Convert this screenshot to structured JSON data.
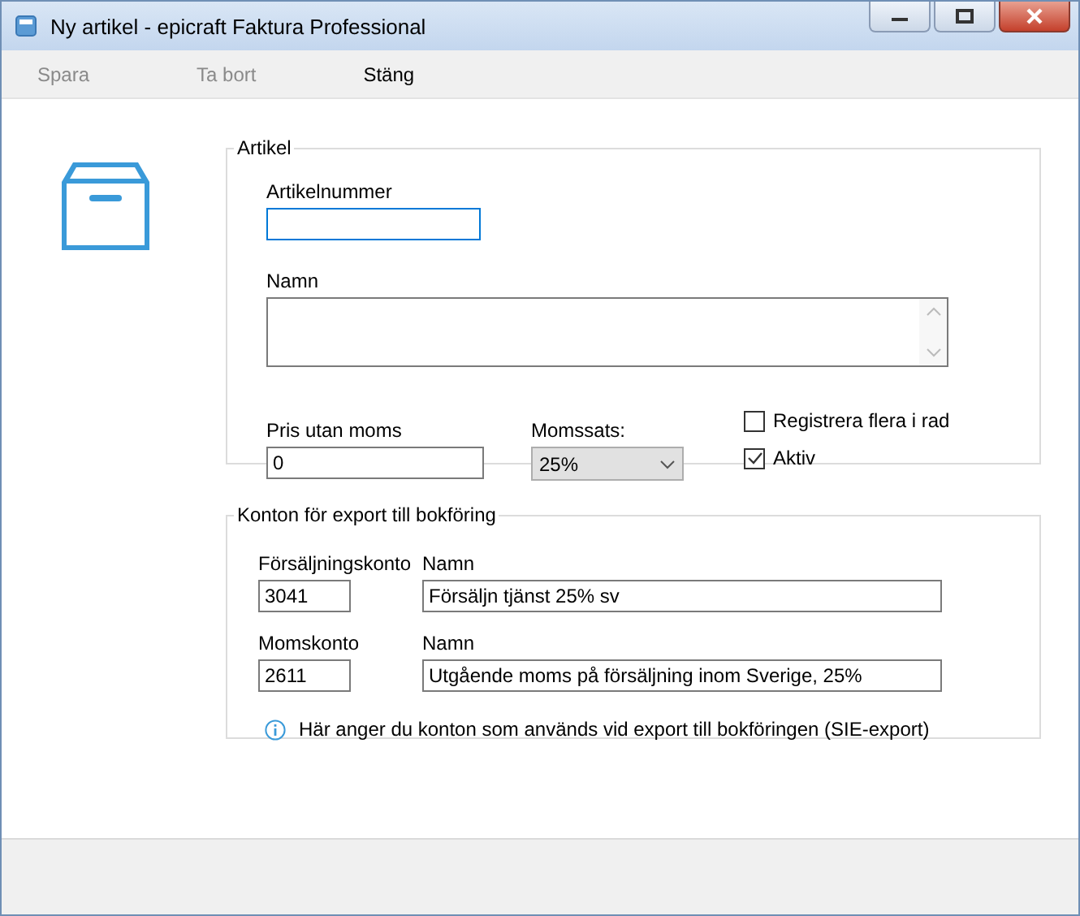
{
  "window": {
    "title": "Ny artikel - epicraft Faktura Professional"
  },
  "toolbar": [
    {
      "label": "Spara",
      "disabled": true
    },
    {
      "label": "Ta bort",
      "disabled": true
    },
    {
      "label": "Stäng",
      "disabled": false
    }
  ],
  "article": {
    "title": "Artikel",
    "article_number": {
      "label": "Artikelnummer",
      "focused": true
    },
    "name": {
      "label": "Namn"
    },
    "price": {
      "label": "Pris utan moms",
      "value": "0"
    },
    "vat_rate": {
      "label": "Momssats:",
      "value": "25%"
    },
    "checkboxes": [
      {
        "label": "Registrera flera i rad",
        "checked": false
      },
      {
        "label": "Aktiv",
        "checked": true
      }
    ]
  },
  "accounts": {
    "title": "Konton för export till bokföring",
    "rows": [
      {
        "account_label": "Försäljningskonto",
        "account": "3041",
        "name_label": "Namn",
        "name": "Försäljn tjänst 25% sv"
      },
      {
        "account_label": "Momskonto",
        "account": "2611",
        "name_label": "Namn",
        "name": "Utgående moms på försäljning inom Sverige, 25%"
      }
    ],
    "info": "Här anger du konton som används vid export till bokföringen (SIE-export)"
  }
}
